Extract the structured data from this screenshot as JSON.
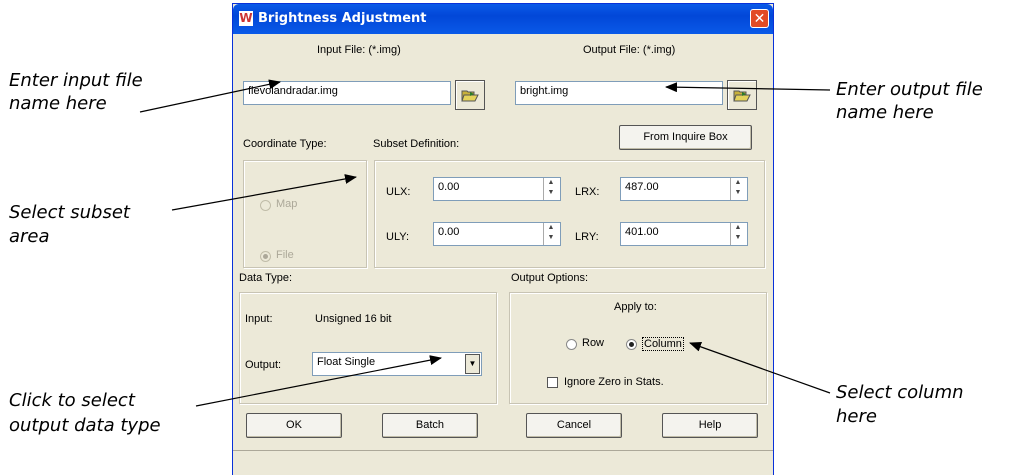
{
  "window": {
    "title": "Brightness Adjustment",
    "close_glyph": "✕",
    "app_glyph": "W"
  },
  "input_file": {
    "label": "Input File: (*.img)",
    "value": "flevolandradar.img"
  },
  "output_file": {
    "label": "Output File: (*.img)",
    "value": "bright.img"
  },
  "inquire_button": "From Inquire Box",
  "coordinate_type": {
    "label": "Coordinate Type:",
    "options": [
      "Map",
      "File"
    ],
    "selected": "File"
  },
  "subset": {
    "label": "Subset Definition:",
    "ulx_label": "ULX:",
    "ulx": "0.00",
    "uly_label": "ULY:",
    "uly": "0.00",
    "lrx_label": "LRX:",
    "lrx": "487.00",
    "lry_label": "LRY:",
    "lry": "401.00"
  },
  "data_type": {
    "label": "Data Type:",
    "input_label": "Input:",
    "input_value": "Unsigned 16 bit",
    "output_label": "Output:",
    "output_value": "Float Single"
  },
  "output_options": {
    "label": "Output Options:",
    "apply_to": "Apply to:",
    "row": "Row",
    "column": "Column",
    "selected": "Column",
    "ignore_zero": "Ignore Zero in Stats."
  },
  "buttons": {
    "ok": "OK",
    "batch": "Batch",
    "cancel": "Cancel",
    "help": "Help"
  },
  "annotations": {
    "input_line1": "Enter input file",
    "input_line2": "name here",
    "output_line1": "Enter output file",
    "output_line2": "name here",
    "subset_line1": "Select subset",
    "subset_line2": "area",
    "datatype_line1": "Click to select",
    "datatype_line2": "output data type",
    "column_line1": "Select column",
    "column_line2": "here"
  },
  "icons": [
    "app-icon",
    "close-icon",
    "folder-open-icon",
    "spin-arrows-icon",
    "dropdown-arrow-icon"
  ]
}
